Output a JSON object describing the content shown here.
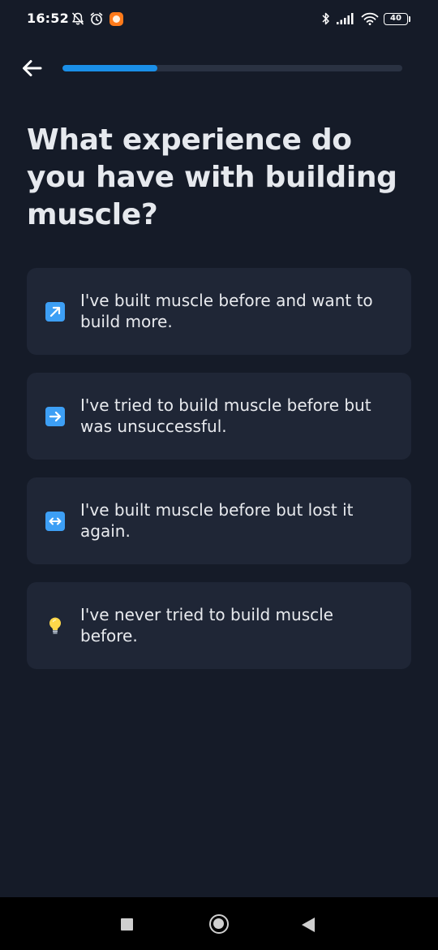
{
  "status_bar": {
    "time": "16:52",
    "battery_level": "40",
    "icons": [
      "bell-off-icon",
      "alarm-icon",
      "app-notification-icon",
      "bluetooth-icon",
      "signal-icon",
      "wifi-icon",
      "battery-icon"
    ]
  },
  "header": {
    "back_icon": "arrow-left-icon",
    "progress_fraction": 0.28,
    "colors": {
      "track": "#2a3242",
      "fill": "#1a8fe8"
    }
  },
  "question": {
    "title": "What experience do you have with building muscle?"
  },
  "options": [
    {
      "icon": "arrow-up-right-emoji",
      "label": "I've built muscle before and want to build more."
    },
    {
      "icon": "arrow-right-emoji",
      "label": "I've tried to build muscle before but was unsuccessful."
    },
    {
      "icon": "arrow-left-right-emoji",
      "label": "I've built muscle before but lost it again."
    },
    {
      "icon": "light-bulb-emoji",
      "label": "I've never tried to build muscle before."
    }
  ],
  "nav_bar": {
    "icons": [
      "recent-apps-icon",
      "home-icon",
      "back-triangle-icon"
    ]
  },
  "theme": {
    "background": "#151b28",
    "card": "#1f2636",
    "text": "#e8eaee",
    "emoji_blue": "#3d9ff5"
  }
}
